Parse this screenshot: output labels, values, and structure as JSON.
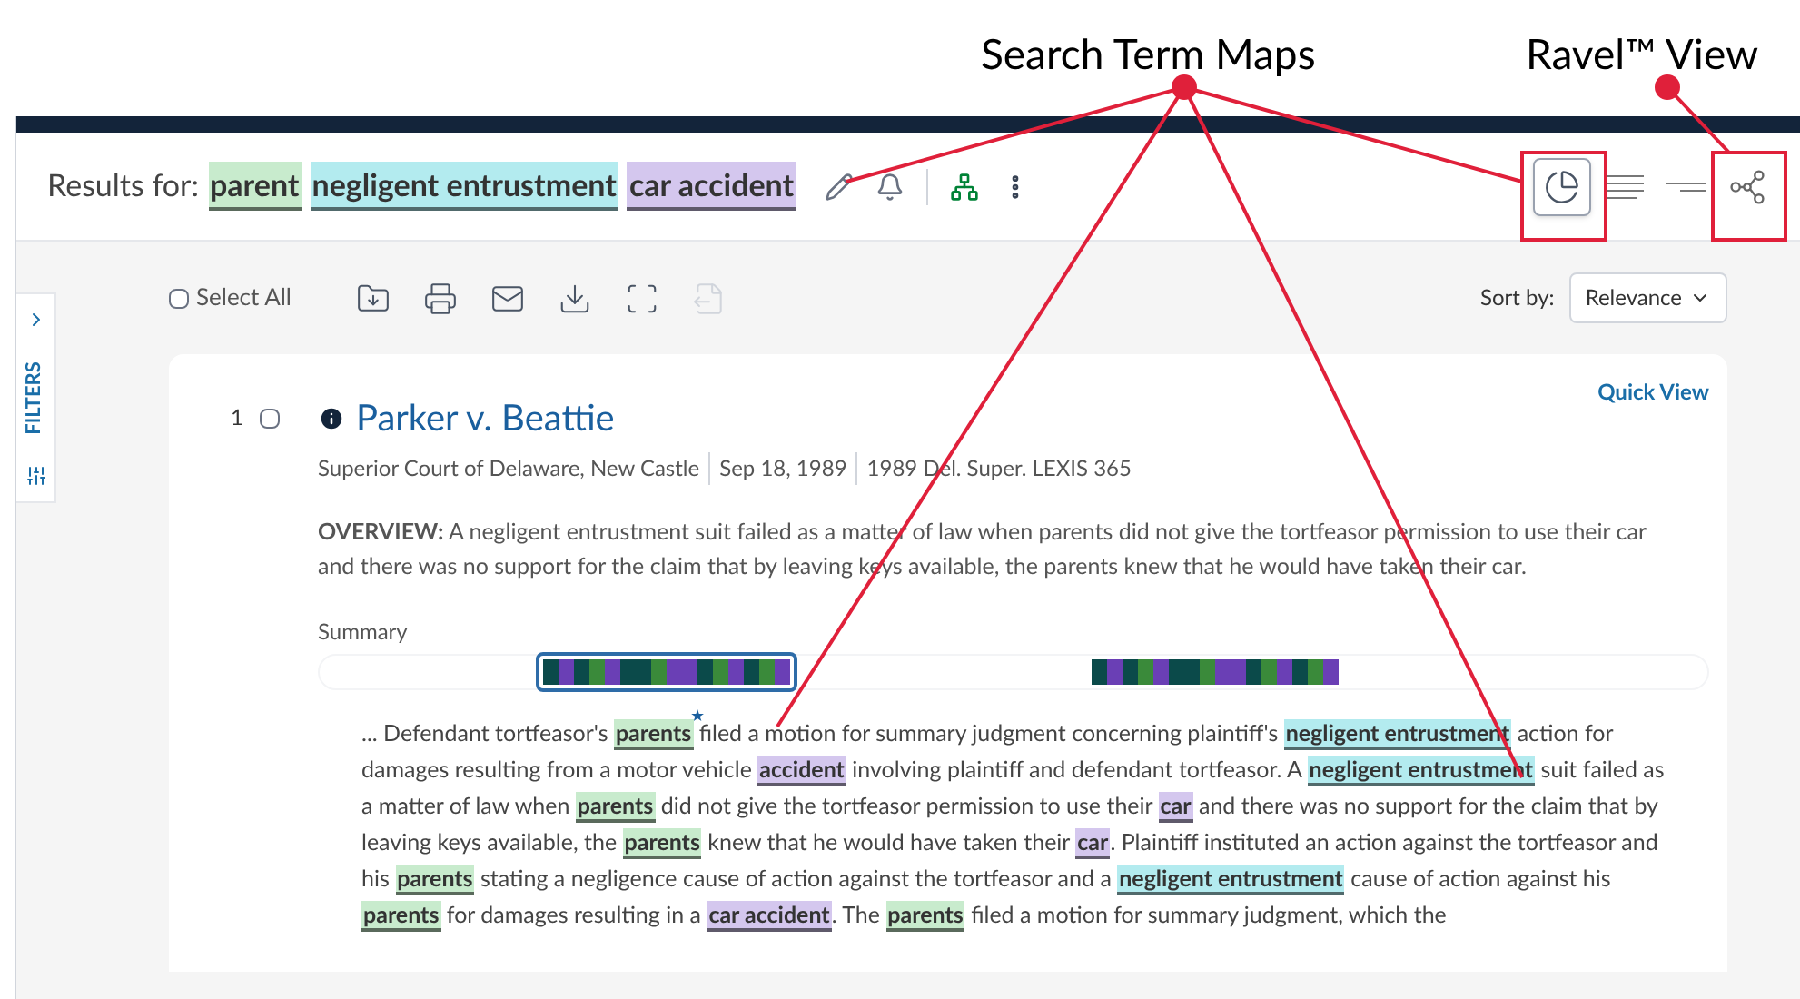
{
  "callouts": [
    {
      "label": "Search Term Maps"
    },
    {
      "label": "Ravel™ View"
    }
  ],
  "header": {
    "prefix": "Results for:",
    "terms": [
      {
        "text": "parent",
        "color": "#c8ebcd"
      },
      {
        "text": "negligent entrustment",
        "color": "#b3ebef"
      },
      {
        "text": "car accident",
        "color": "#d4c7ee"
      }
    ]
  },
  "views": [
    {
      "kind": "term-map",
      "selected": true
    },
    {
      "kind": "full-list",
      "selected": false
    },
    {
      "kind": "short-list",
      "selected": false
    },
    {
      "kind": "ravel",
      "selected": false
    }
  ],
  "filters_tab": {
    "label": "FILTERS"
  },
  "toolbar": {
    "select_all": {
      "label": "Select All",
      "checked": false
    },
    "tools": [
      {
        "kind": "folder",
        "disabled": false
      },
      {
        "kind": "print",
        "disabled": false
      },
      {
        "kind": "email",
        "disabled": false
      },
      {
        "kind": "download",
        "disabled": false
      },
      {
        "kind": "expand",
        "disabled": false
      },
      {
        "kind": "export",
        "disabled": true
      }
    ],
    "sort_label": "Sort by:",
    "sort_value": "Relevance"
  },
  "result": {
    "number": "1",
    "checked": false,
    "quick_view": "Quick View",
    "title": "Parker v. Beattie",
    "meta": [
      "Superior Court of Delaware, New Castle",
      "Sep 18, 1989",
      "1989 Del. Super. LEXIS 365"
    ],
    "overview_label": "OVERVIEW:",
    "overview": "A negligent entrustment suit failed as a matter of law when parents did not give the tortfeasor permission to use their car and there was no support for the claim that by leaving keys available, the parents knew that he would have taken their car.",
    "summary_label": "Summary",
    "term_maps": [
      {
        "selected": true
      },
      {
        "selected": false
      }
    ],
    "marker": "★",
    "excerpt": [
      {
        "text": "... Defendant tortfeasor's "
      },
      {
        "text": "parents",
        "color": "#c8ebcd"
      },
      {
        "text": " filed a motion for summary judgment concerning plaintiff's "
      },
      {
        "text": "negligent entrustment",
        "color": "#b3ebef"
      },
      {
        "text": " action for damages resulting from a motor vehicle "
      },
      {
        "text": "accident",
        "color": "#d4c7ee"
      },
      {
        "text": " involving plaintiff and defendant tortfeasor. A "
      },
      {
        "text": "negligent entrustment",
        "color": "#b3ebef"
      },
      {
        "text": " suit failed as a matter of law when "
      },
      {
        "text": "parents",
        "color": "#c8ebcd"
      },
      {
        "text": " did not give the tortfeasor permission to use their "
      },
      {
        "text": "car",
        "color": "#d4c7ee"
      },
      {
        "text": " and there was no support for the claim that by leaving keys available, the "
      },
      {
        "text": "parents",
        "color": "#c8ebcd"
      },
      {
        "text": " knew that he would have taken their "
      },
      {
        "text": "car",
        "color": "#d4c7ee"
      },
      {
        "text": ". Plaintiff instituted an action against the tortfeasor and his "
      },
      {
        "text": "parents",
        "color": "#c8ebcd"
      },
      {
        "text": " stating a negligence cause of action against the tortfeasor and a "
      },
      {
        "text": "negligent entrustment",
        "color": "#b3ebef"
      },
      {
        "text": " cause of action against his "
      },
      {
        "text": "parents",
        "color": "#c8ebcd"
      },
      {
        "text": " for damages resulting in a "
      },
      {
        "text": "car accident",
        "color": "#d4c7ee"
      },
      {
        "text": ". The "
      },
      {
        "text": "parents",
        "color": "#c8ebcd"
      },
      {
        "text": " filed a motion for summary judgment, which the"
      }
    ]
  }
}
